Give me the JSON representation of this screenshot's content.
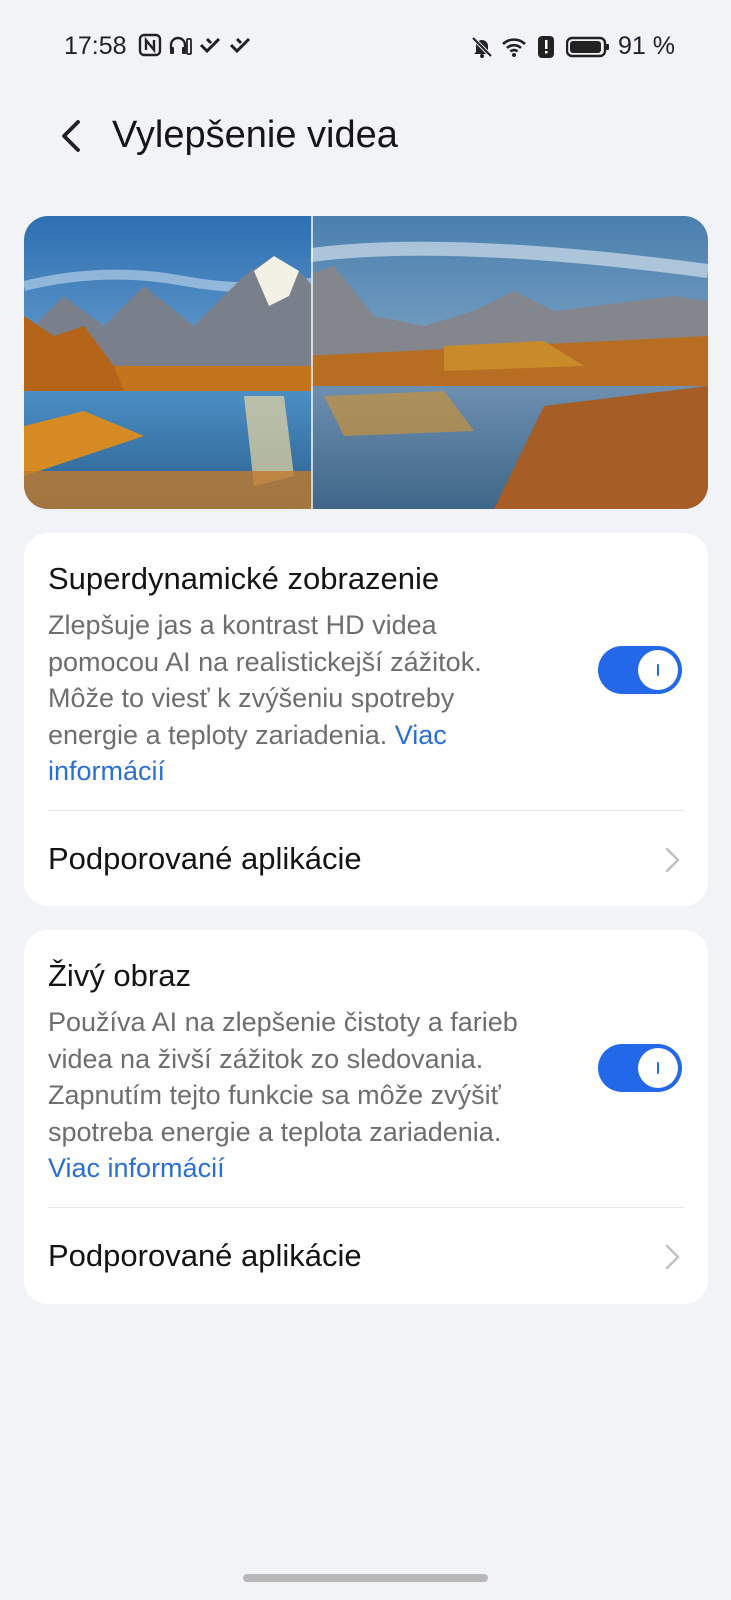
{
  "status_bar": {
    "time": "17:58",
    "battery_percent": "91 %",
    "left_icons": [
      "nfc-icon",
      "headphones-battery-icon",
      "signal-weak-icon",
      "signal-weak-icon"
    ],
    "right_icons": [
      "bell-off-icon",
      "wifi-icon",
      "alert-icon",
      "battery-icon"
    ]
  },
  "header": {
    "title": "Vylepšenie videa"
  },
  "card1": {
    "title": "Superdynamické zobrazenie",
    "description": "Zlepšuje jas a kontrast HD videa pomocou AI na realistickejší zážitok. Môže to viesť k zvýšeniu spotreby energie a teploty zariadenia.",
    "more_link": "Viac informácií",
    "toggle_on": true,
    "row_label": "Podporované aplikácie"
  },
  "card2": {
    "title": "Živý obraz",
    "description": "Používa AI na zlepšenie čistoty a farieb videa na živší zážitok zo sledovania. Zapnutím tejto funkcie sa môže zvýšiť spotreba energie a teplota zariadenia.",
    "more_link": "Viac informácií",
    "toggle_on": true,
    "row_label": "Podporované aplikácie"
  },
  "colors": {
    "accent": "#2268e8",
    "link": "#2a6fd6",
    "background": "#f1f3f6"
  }
}
